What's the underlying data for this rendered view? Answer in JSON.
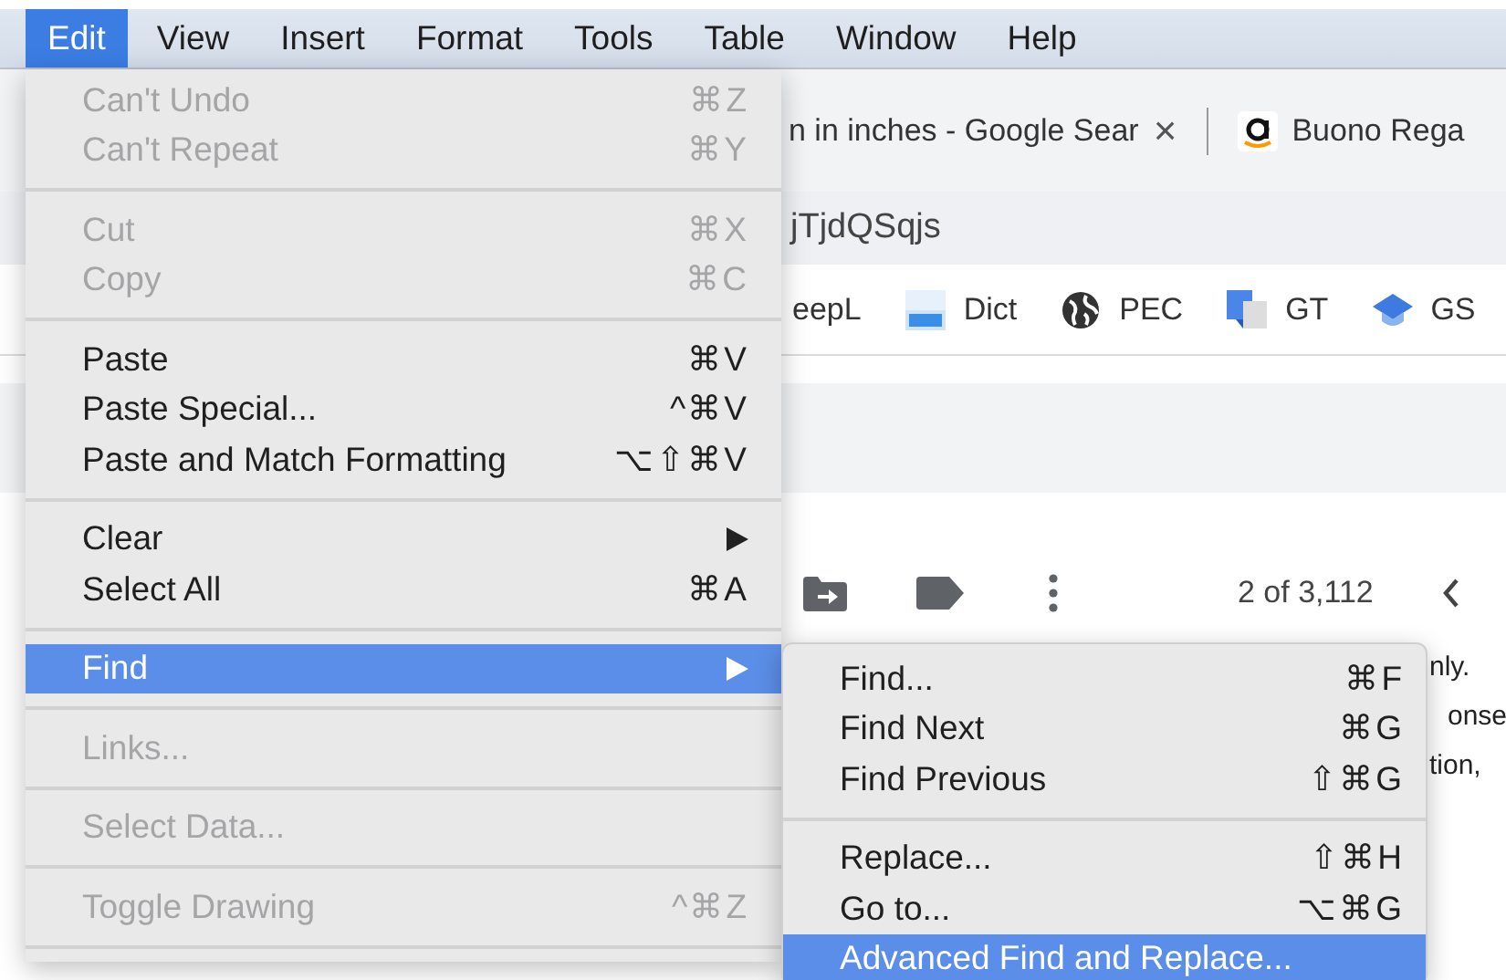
{
  "menubar": [
    {
      "label": "Edit",
      "selected": true
    },
    {
      "label": "View",
      "selected": false
    },
    {
      "label": "Insert",
      "selected": false
    },
    {
      "label": "Format",
      "selected": false
    },
    {
      "label": "Tools",
      "selected": false
    },
    {
      "label": "Table",
      "selected": false
    },
    {
      "label": "Window",
      "selected": false
    },
    {
      "label": "Help",
      "selected": false
    }
  ],
  "browser": {
    "tabs": [
      {
        "title": "n in inches - Google Sear",
        "close": "×",
        "kind": "plain"
      },
      {
        "title": "Buono Rega",
        "kind": "amazon"
      }
    ],
    "address": "jTjdQSqjs",
    "bookmarks": [
      {
        "label": "eepL",
        "kind": "none"
      },
      {
        "label": "Dict",
        "kind": "dictionary"
      },
      {
        "label": "PEC",
        "kind": "globe"
      },
      {
        "label": "GT",
        "kind": "translate"
      },
      {
        "label": "GS",
        "kind": "cap"
      }
    ],
    "mail_toolbar": {
      "counter": "2 of 3,112"
    },
    "mail_text": [
      "nly.",
      "onse",
      "tion,"
    ]
  },
  "edit_menu": {
    "items": [
      {
        "kind": "item",
        "label": "Can't Undo",
        "shortcut": "⌘Z",
        "disabled": true,
        "selected": false,
        "has_submenu": false
      },
      {
        "kind": "item",
        "label": "Can't Repeat",
        "shortcut": "⌘Y",
        "disabled": true,
        "selected": false,
        "has_submenu": false
      },
      {
        "kind": "separator"
      },
      {
        "kind": "item",
        "label": "Cut",
        "shortcut": "⌘X",
        "disabled": true,
        "selected": false,
        "has_submenu": false
      },
      {
        "kind": "item",
        "label": "Copy",
        "shortcut": "⌘C",
        "disabled": true,
        "selected": false,
        "has_submenu": false
      },
      {
        "kind": "separator"
      },
      {
        "kind": "item",
        "label": "Paste",
        "shortcut": "⌘V",
        "disabled": false,
        "selected": false,
        "has_submenu": false
      },
      {
        "kind": "item",
        "label": "Paste Special...",
        "shortcut": "^⌘V",
        "disabled": false,
        "selected": false,
        "has_submenu": false
      },
      {
        "kind": "item",
        "label": "Paste and Match Formatting",
        "shortcut": "⌥⇧⌘V",
        "disabled": false,
        "selected": false,
        "has_submenu": false
      },
      {
        "kind": "separator"
      },
      {
        "kind": "item",
        "label": "Clear",
        "disabled": false,
        "selected": false,
        "has_submenu": true
      },
      {
        "kind": "item",
        "label": "Select All",
        "shortcut": "⌘A",
        "disabled": false,
        "selected": false,
        "has_submenu": false
      },
      {
        "kind": "separator"
      },
      {
        "kind": "item",
        "label": "Find",
        "disabled": false,
        "selected": true,
        "has_submenu": true
      },
      {
        "kind": "separator"
      },
      {
        "kind": "item",
        "label": "Links...",
        "disabled": true,
        "selected": false,
        "has_submenu": false
      },
      {
        "kind": "separator"
      },
      {
        "kind": "item",
        "label": "Select Data...",
        "disabled": true,
        "selected": false,
        "has_submenu": false
      },
      {
        "kind": "separator"
      },
      {
        "kind": "item",
        "label": "Toggle Drawing",
        "shortcut": "^⌘Z",
        "disabled": true,
        "selected": false,
        "has_submenu": false
      },
      {
        "kind": "separator"
      }
    ]
  },
  "find_submenu": {
    "items": [
      {
        "kind": "item",
        "label": "Find...",
        "shortcut": "⌘F",
        "selected": false
      },
      {
        "kind": "item",
        "label": "Find Next",
        "shortcut": "⌘G",
        "selected": false
      },
      {
        "kind": "item",
        "label": "Find Previous",
        "shortcut": "⇧⌘G",
        "selected": false
      },
      {
        "kind": "separator"
      },
      {
        "kind": "item",
        "label": "Replace...",
        "shortcut": "⇧⌘H",
        "selected": false
      },
      {
        "kind": "item",
        "label": "Go to...",
        "shortcut": "⌥⌘G",
        "selected": false
      },
      {
        "kind": "item",
        "label": "Advanced Find and Replace...",
        "selected": true
      }
    ]
  }
}
